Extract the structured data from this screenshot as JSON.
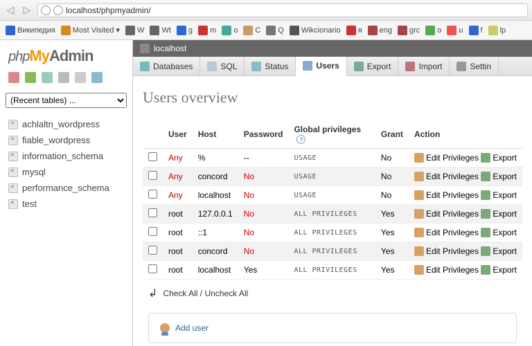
{
  "url": "localhost/phpmyadmin/",
  "bookmarks": [
    {
      "label": "Википедия",
      "color": "#36c"
    },
    {
      "label": "Most Visited",
      "color": "#d88a1a",
      "dropdown": true
    },
    {
      "label": "W",
      "color": "#666"
    },
    {
      "label": "Wt",
      "color": "#666"
    },
    {
      "label": "g",
      "color": "#2a6cd6"
    },
    {
      "label": "m",
      "color": "#c33"
    },
    {
      "label": "o",
      "color": "#4a9"
    },
    {
      "label": "C",
      "color": "#c96"
    },
    {
      "label": "Q",
      "color": "#777"
    },
    {
      "label": "Wikcionario",
      "color": "#555"
    },
    {
      "label": "я",
      "color": "#c33"
    },
    {
      "label": "eng",
      "color": "#a44"
    },
    {
      "label": "grc",
      "color": "#a44"
    },
    {
      "label": "o",
      "color": "#5a5"
    },
    {
      "label": "u",
      "color": "#e55"
    },
    {
      "label": "f",
      "color": "#36c"
    },
    {
      "label": "lp",
      "color": "#cc6"
    }
  ],
  "logo": {
    "php": "php",
    "my": "My",
    "admin": "Admin"
  },
  "recent_tables": "(Recent tables) ...",
  "databases": [
    "achlaltn_wordpress",
    "fiable_wordpress",
    "information_schema",
    "mysql",
    "performance_schema",
    "test"
  ],
  "breadcrumb": {
    "server": "localhost"
  },
  "tabs": [
    {
      "id": "databases",
      "label": "Databases",
      "color": "#7bb"
    },
    {
      "id": "sql",
      "label": "SQL",
      "color": "#b8c8d8"
    },
    {
      "id": "status",
      "label": "Status",
      "color": "#8bc"
    },
    {
      "id": "users",
      "label": "Users",
      "color": "#8ac",
      "active": true
    },
    {
      "id": "export",
      "label": "Export",
      "color": "#7a9"
    },
    {
      "id": "import",
      "label": "Import",
      "color": "#b77"
    },
    {
      "id": "settings",
      "label": "Settin",
      "color": "#999"
    }
  ],
  "heading": "Users overview",
  "columns": {
    "user": "User",
    "host": "Host",
    "password": "Password",
    "gp": "Global privileges",
    "grant": "Grant",
    "action": "Action"
  },
  "rows": [
    {
      "user": "Any",
      "user_red": true,
      "host": "%",
      "password": "--",
      "pw_red": false,
      "priv": "USAGE",
      "grant": "No",
      "alt": false
    },
    {
      "user": "Any",
      "user_red": true,
      "host": "concord",
      "password": "No",
      "pw_red": true,
      "priv": "USAGE",
      "grant": "No",
      "alt": true
    },
    {
      "user": "Any",
      "user_red": true,
      "host": "localhost",
      "password": "No",
      "pw_red": true,
      "priv": "USAGE",
      "grant": "No",
      "alt": false
    },
    {
      "user": "root",
      "user_red": false,
      "host": "127.0.0.1",
      "password": "No",
      "pw_red": true,
      "priv": "ALL PRIVILEGES",
      "grant": "Yes",
      "alt": true
    },
    {
      "user": "root",
      "user_red": false,
      "host": "::1",
      "password": "No",
      "pw_red": true,
      "priv": "ALL PRIVILEGES",
      "grant": "Yes",
      "alt": false
    },
    {
      "user": "root",
      "user_red": false,
      "host": "concord",
      "password": "No",
      "pw_red": true,
      "priv": "ALL PRIVILEGES",
      "grant": "Yes",
      "alt": true
    },
    {
      "user": "root",
      "user_red": false,
      "host": "localhost",
      "password": "Yes",
      "pw_red": false,
      "priv": "ALL PRIVILEGES",
      "grant": "Yes",
      "alt": false
    }
  ],
  "actions": {
    "edit": "Edit Privileges",
    "export": "Export"
  },
  "checkall": {
    "check": "Check All",
    "uncheck": "Uncheck All",
    "sep": " / "
  },
  "adduser": "Add user"
}
